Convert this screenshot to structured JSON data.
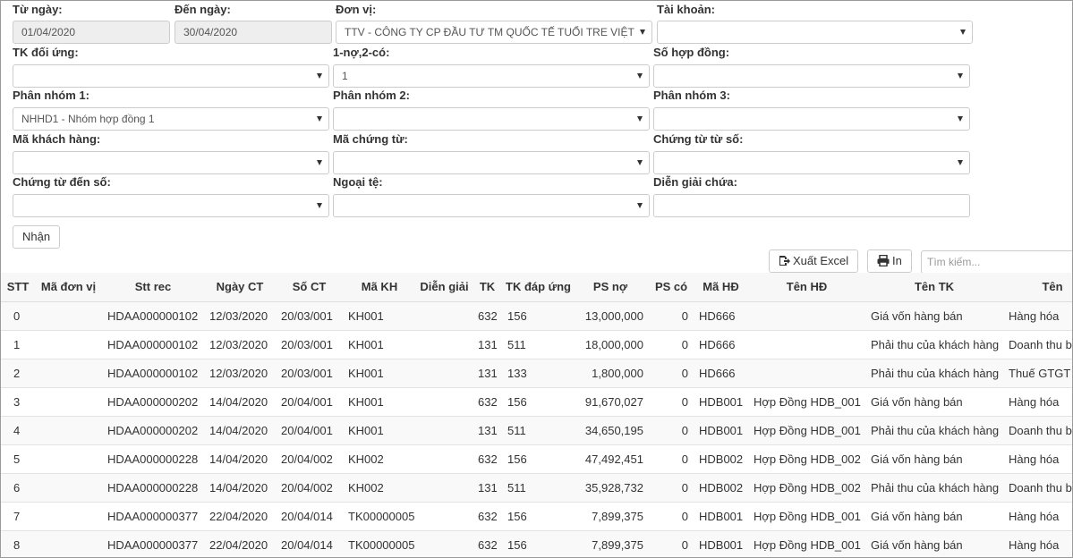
{
  "filters": {
    "tu_ngay": {
      "label": "Từ ngày:",
      "value": "01/04/2020"
    },
    "den_ngay": {
      "label": "Đến ngày:",
      "value": "30/04/2020"
    },
    "don_vi": {
      "label": "Đơn vị:",
      "value": "TTV - CÔNG TY CP ĐẦU TƯ TM QUỐC TẾ TUỔI TRE VIỆT"
    },
    "tai_khoan": {
      "label": "Tài khoản:",
      "value": ""
    },
    "tk_doi_ung": {
      "label": "TK đối ứng:",
      "value": ""
    },
    "no_co": {
      "label": "1-nợ,2-có:",
      "value": "1"
    },
    "so_hop_dong": {
      "label": "Số hợp đồng:",
      "value": ""
    },
    "phan_nhom_1": {
      "label": "Phân nhóm 1:",
      "value": "NHHD1 - Nhóm hợp đồng 1"
    },
    "phan_nhom_2": {
      "label": "Phân nhóm 2:",
      "value": ""
    },
    "phan_nhom_3": {
      "label": "Phân nhóm 3:",
      "value": ""
    },
    "ma_khach_hang": {
      "label": "Mã khách hàng:",
      "value": ""
    },
    "ma_chung_tu": {
      "label": "Mã chứng từ:",
      "value": ""
    },
    "chung_tu_tu_so": {
      "label": "Chứng từ từ số:",
      "value": ""
    },
    "chung_tu_den_so": {
      "label": "Chứng từ đến số:",
      "value": ""
    },
    "ngoai_te": {
      "label": "Ngoại tệ:",
      "value": ""
    },
    "dien_giai_chua": {
      "label": "Diễn giải chứa:",
      "value": ""
    }
  },
  "buttons": {
    "nhan": "Nhận",
    "xuat_excel": "Xuất Excel",
    "in": "In"
  },
  "search": {
    "placeholder": "Tìm kiếm..."
  },
  "table": {
    "headers": [
      "STT",
      "Mã đơn vị",
      "Stt rec",
      "Ngày CT",
      "Số CT",
      "Mã KH",
      "Diễn giải",
      "TK",
      "TK đáp ứng",
      "PS nợ",
      "PS có",
      "Mã HĐ",
      "Tên HĐ",
      "Tên TK",
      "Tên"
    ],
    "rows": [
      [
        "0",
        "",
        "HDAA000000102",
        "12/03/2020",
        "20/03/001",
        "KH001",
        "",
        "632",
        "156",
        "13,000,000",
        "0",
        "HD666",
        "",
        "Giá vốn hàng bán",
        "Hàng hóa"
      ],
      [
        "1",
        "",
        "HDAA000000102",
        "12/03/2020",
        "20/03/001",
        "KH001",
        "",
        "131",
        "511",
        "18,000,000",
        "0",
        "HD666",
        "",
        "Phải thu của khách hàng",
        "Doanh thu b"
      ],
      [
        "2",
        "",
        "HDAA000000102",
        "12/03/2020",
        "20/03/001",
        "KH001",
        "",
        "131",
        "133",
        "1,800,000",
        "0",
        "HD666",
        "",
        "Phải thu của khách hàng",
        "Thuế GTGT"
      ],
      [
        "3",
        "",
        "HDAA000000202",
        "14/04/2020",
        "20/04/001",
        "KH001",
        "",
        "632",
        "156",
        "91,670,027",
        "0",
        "HDB001",
        "Hợp Đồng HDB_001",
        "Giá vốn hàng bán",
        "Hàng hóa"
      ],
      [
        "4",
        "",
        "HDAA000000202",
        "14/04/2020",
        "20/04/001",
        "KH001",
        "",
        "131",
        "511",
        "34,650,195",
        "0",
        "HDB001",
        "Hợp Đồng HDB_001",
        "Phải thu của khách hàng",
        "Doanh thu b"
      ],
      [
        "5",
        "",
        "HDAA000000228",
        "14/04/2020",
        "20/04/002",
        "KH002",
        "",
        "632",
        "156",
        "47,492,451",
        "0",
        "HDB002",
        "Hợp Đồng HDB_002",
        "Giá vốn hàng bán",
        "Hàng hóa"
      ],
      [
        "6",
        "",
        "HDAA000000228",
        "14/04/2020",
        "20/04/002",
        "KH002",
        "",
        "131",
        "511",
        "35,928,732",
        "0",
        "HDB002",
        "Hợp Đồng HDB_002",
        "Phải thu của khách hàng",
        "Doanh thu b"
      ],
      [
        "7",
        "",
        "HDAA000000377",
        "22/04/2020",
        "20/04/014",
        "TK00000005",
        "",
        "632",
        "156",
        "7,899,375",
        "0",
        "HDB001",
        "Hợp Đồng HDB_001",
        "Giá vốn hàng bán",
        "Hàng hóa"
      ],
      [
        "8",
        "",
        "HDAA000000377",
        "22/04/2020",
        "20/04/014",
        "TK00000005",
        "",
        "632",
        "156",
        "7,899,375",
        "0",
        "HDB001",
        "Hợp Đồng HDB_001",
        "Giá vốn hàng bán",
        "Hàng hóa"
      ]
    ]
  },
  "icons": {
    "excel": "file-export-icon",
    "print": "printer-icon",
    "dropdown": "caret-down-icon"
  }
}
